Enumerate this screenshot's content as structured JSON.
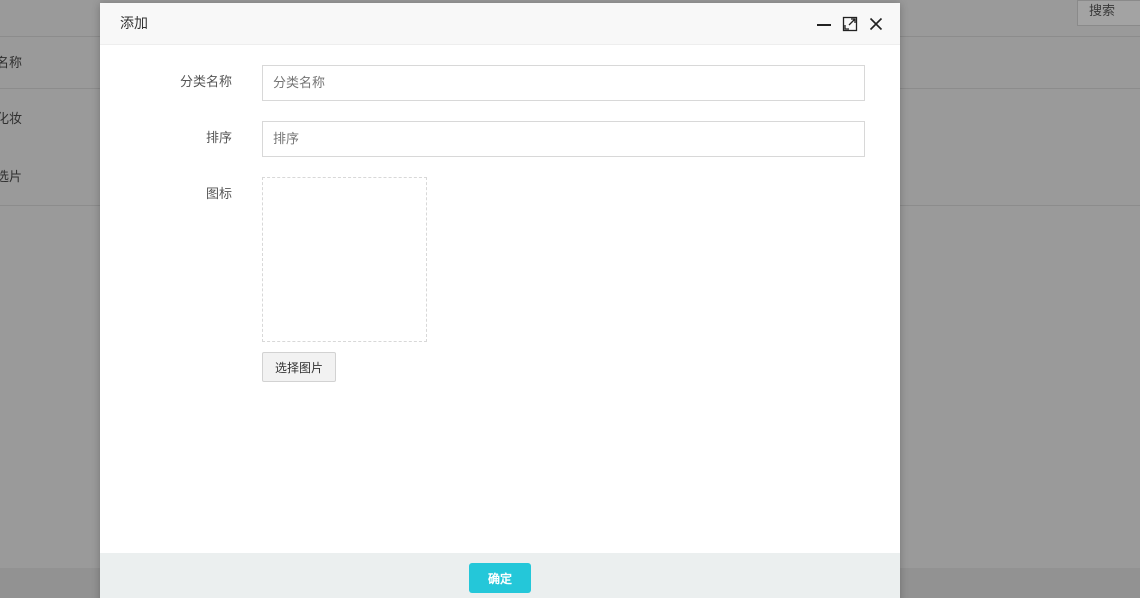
{
  "background": {
    "search_button_label": "搜索",
    "rows": [
      {
        "label": "名称"
      },
      {
        "label": "化妆"
      },
      {
        "label": "选片"
      }
    ]
  },
  "dialog": {
    "title": "添加",
    "fields": {
      "category_name": {
        "label": "分类名称",
        "placeholder": "分类名称",
        "value": ""
      },
      "sort": {
        "label": "排序",
        "placeholder": "排序",
        "value": ""
      },
      "icon": {
        "label": "图标",
        "choose_button_label": "选择图片"
      }
    },
    "footer": {
      "confirm_label": "确定"
    }
  },
  "colors": {
    "accent": "#24c7d9",
    "overlay": "#9a9a9a",
    "footer_bg": "#ebefef",
    "header_bg": "#f8f8f8"
  },
  "icons": {
    "minimize": "minimize-icon",
    "maximize": "maximize-icon",
    "close": "close-icon"
  }
}
